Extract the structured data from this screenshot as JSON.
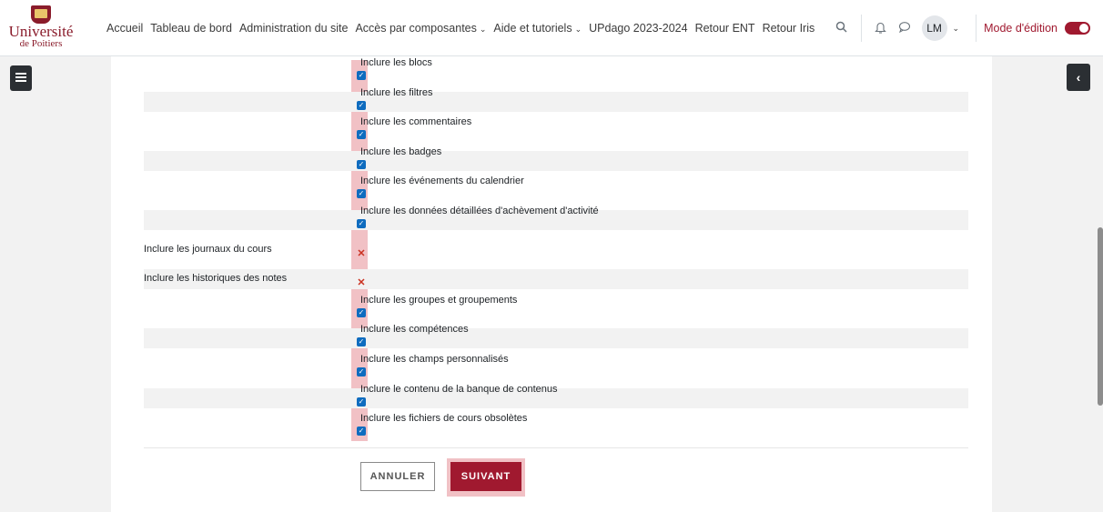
{
  "brand": {
    "line1": "Université",
    "line2": "de Poitiers"
  },
  "nav": {
    "items": [
      {
        "label": "Accueil",
        "dropdown": false
      },
      {
        "label": "Tableau de bord",
        "dropdown": false
      },
      {
        "label": "Administration du site",
        "dropdown": false
      },
      {
        "label": "Accès par composantes",
        "dropdown": true
      },
      {
        "label": "Aide et tutoriels",
        "dropdown": true
      },
      {
        "label": "UPdago 2023-2024",
        "dropdown": false
      },
      {
        "label": "Retour ENT",
        "dropdown": false
      },
      {
        "label": "Retour Iris",
        "dropdown": false
      }
    ],
    "chevron": "⌄"
  },
  "user": {
    "initials": "LM",
    "edit_mode_label": "Mode d'édition"
  },
  "settings": [
    {
      "label": "",
      "option": "Inclure les blocs",
      "state": "checked"
    },
    {
      "label": "",
      "option": "Inclure les filtres",
      "state": "checked"
    },
    {
      "label": "",
      "option": "Inclure les commentaires",
      "state": "checked"
    },
    {
      "label": "",
      "option": "Inclure les badges",
      "state": "checked"
    },
    {
      "label": "",
      "option": "Inclure les événements du calendrier",
      "state": "checked"
    },
    {
      "label": "",
      "option": "Inclure les données détaillées d'achèvement d'activité",
      "state": "checked"
    },
    {
      "label": "Inclure les journaux du cours",
      "option": "",
      "state": "excluded"
    },
    {
      "label": "Inclure les historiques des notes",
      "option": "",
      "state": "excluded"
    },
    {
      "label": "",
      "option": "Inclure les groupes et groupements",
      "state": "checked"
    },
    {
      "label": "",
      "option": "Inclure les compétences",
      "state": "checked"
    },
    {
      "label": "",
      "option": "Inclure les champs personnalisés",
      "state": "checked"
    },
    {
      "label": "",
      "option": "Inclure le contenu de la banque de contenus",
      "state": "checked"
    },
    {
      "label": "",
      "option": "Inclure les fichiers de cours obsolètes",
      "state": "checked"
    }
  ],
  "actions": {
    "cancel_label": "ANNULER",
    "next_label": "SUIVANT"
  }
}
